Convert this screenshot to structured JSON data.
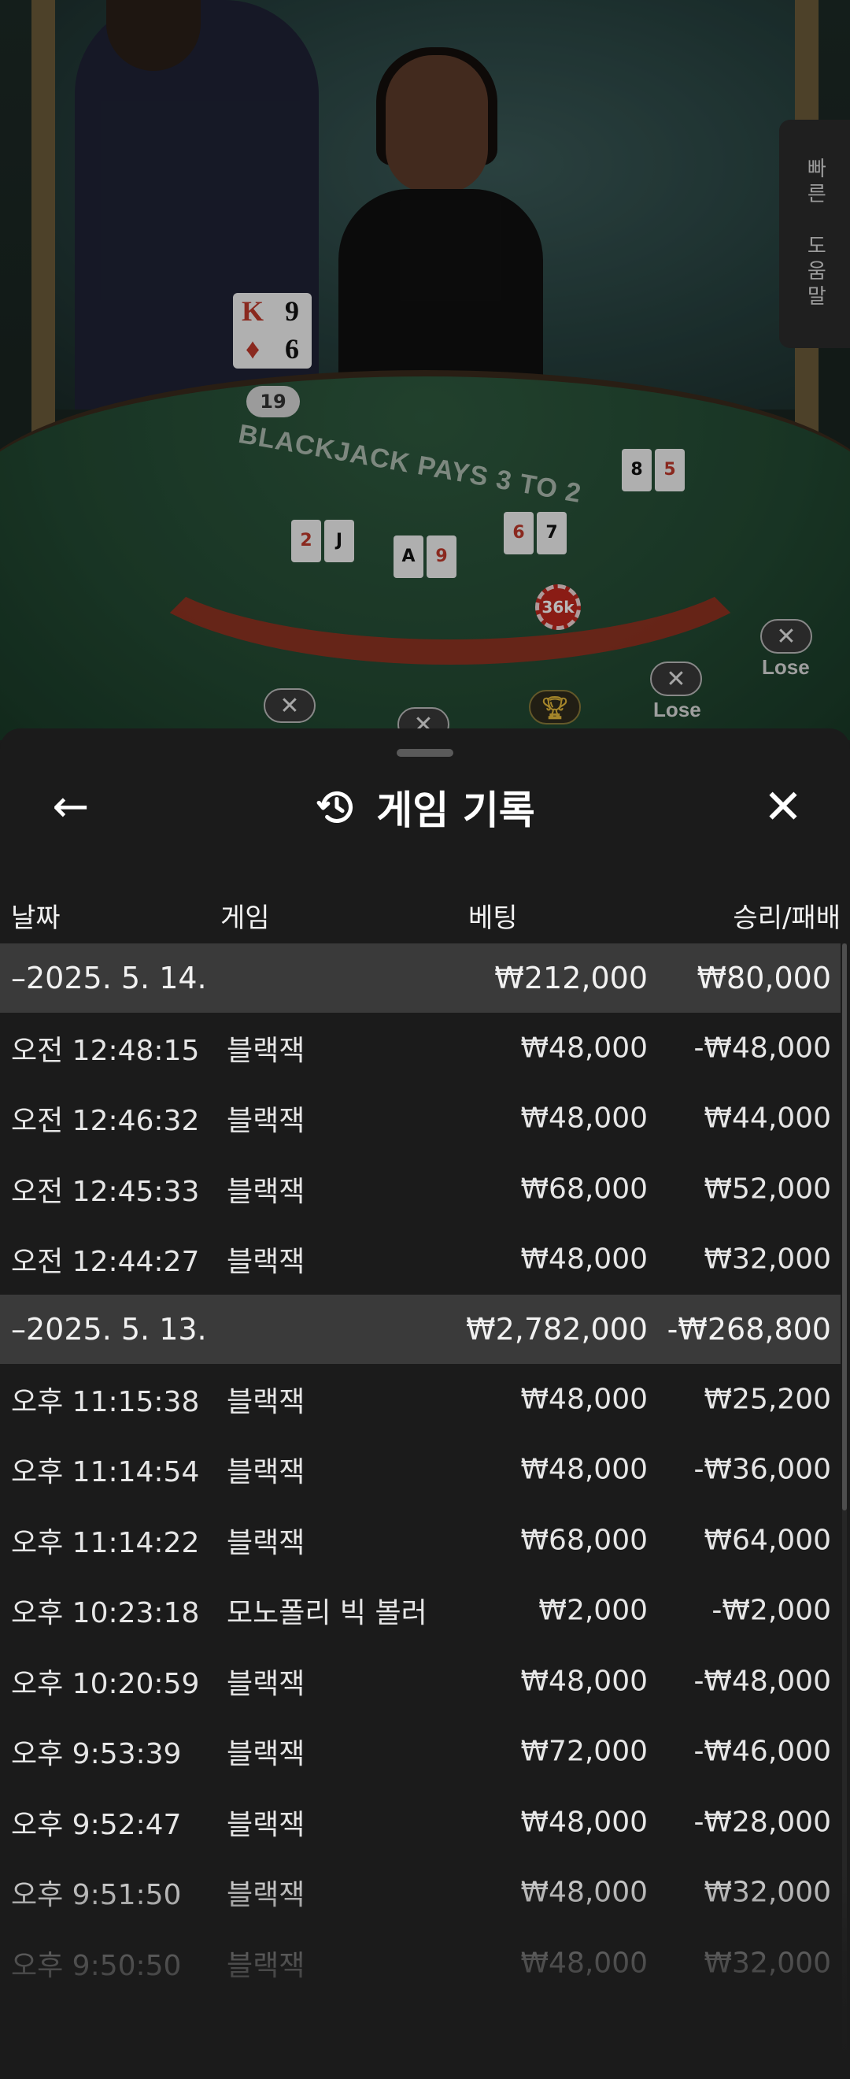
{
  "scene": {
    "dealer_cards": [
      "K",
      "9",
      "♦",
      "6"
    ],
    "dealer_score": "19",
    "chip_label": "36k",
    "table_text": "BLACKJACK PAYS 3 TO 2",
    "lose_label_1": "Lose",
    "lose_label_2": "Lose",
    "help_tab_line1": "빠른",
    "help_tab_line2": "도움말"
  },
  "history": {
    "title": "게임 기록",
    "columns": {
      "date": "날짜",
      "game": "게임",
      "bet": "베팅",
      "result": "승리/패배"
    },
    "groups": [
      {
        "date": "–2025. 5. 14.",
        "bet_total": "₩212,000",
        "result_total": "₩80,000",
        "rows": [
          {
            "time": "오전 12:48:15",
            "game": "블랙잭",
            "bet": "₩48,000",
            "result": "-₩48,000"
          },
          {
            "time": "오전 12:46:32",
            "game": "블랙잭",
            "bet": "₩48,000",
            "result": "₩44,000"
          },
          {
            "time": "오전 12:45:33",
            "game": "블랙잭",
            "bet": "₩68,000",
            "result": "₩52,000"
          },
          {
            "time": "오전 12:44:27",
            "game": "블랙잭",
            "bet": "₩48,000",
            "result": "₩32,000"
          }
        ]
      },
      {
        "date": "–2025. 5. 13.",
        "bet_total": "₩2,782,000",
        "result_total": "-₩268,800",
        "rows": [
          {
            "time": "오후 11:15:38",
            "game": "블랙잭",
            "bet": "₩48,000",
            "result": "₩25,200"
          },
          {
            "time": "오후 11:14:54",
            "game": "블랙잭",
            "bet": "₩48,000",
            "result": "-₩36,000"
          },
          {
            "time": "오후 11:14:22",
            "game": "블랙잭",
            "bet": "₩68,000",
            "result": "₩64,000"
          },
          {
            "time": "오후 10:23:18",
            "game": "모노폴리 빅 볼러",
            "bet": "₩2,000",
            "result": "-₩2,000"
          },
          {
            "time": "오후 10:20:59",
            "game": "블랙잭",
            "bet": "₩48,000",
            "result": "-₩48,000"
          },
          {
            "time": "오후 9:53:39",
            "game": "블랙잭",
            "bet": "₩72,000",
            "result": "-₩46,000"
          },
          {
            "time": "오후 9:52:47",
            "game": "블랙잭",
            "bet": "₩48,000",
            "result": "-₩28,000"
          },
          {
            "time": "오후 9:51:50",
            "game": "블랙잭",
            "bet": "₩48,000",
            "result": "₩32,000"
          },
          {
            "time": "오후 9:50:50",
            "game": "블랙잭",
            "bet": "₩48,000",
            "result": "₩32,000"
          }
        ]
      }
    ]
  }
}
